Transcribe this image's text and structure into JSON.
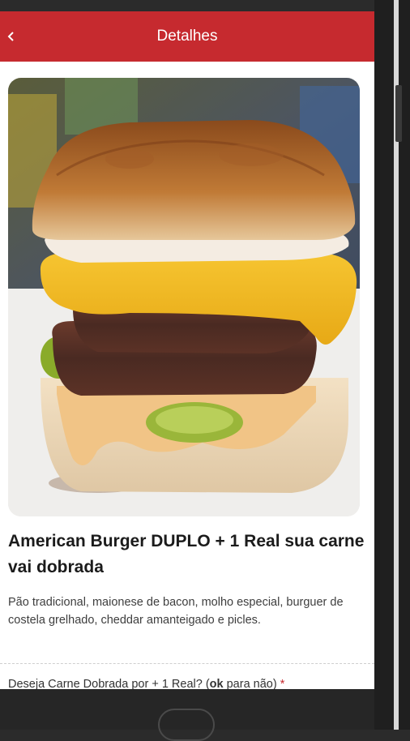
{
  "header": {
    "title": "Detalhes",
    "back_icon": "chevron-left-icon",
    "background": "#c62a2f"
  },
  "product": {
    "image_alt": "American Burger DUPLO",
    "title": "American Burger DUPLO + 1 Real sua carne vai dobrada",
    "description": "Pão tradicional, maionese de bacon, molho especial, burguer de costela grelhado, cheddar amanteigado e picles."
  },
  "options": {
    "question_prefix": "Deseja Carne Dobrada por + 1 Real? (",
    "question_bold": "ok",
    "question_suffix": " para não)",
    "required_marker": "*"
  }
}
